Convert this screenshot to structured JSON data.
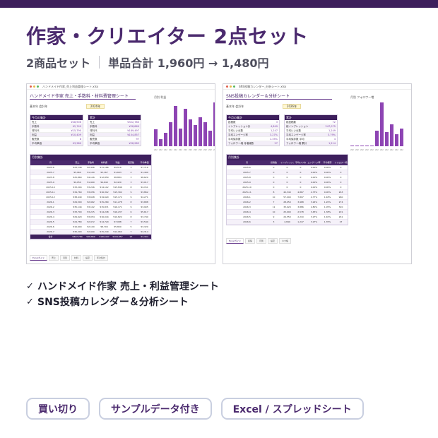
{
  "title": "作家・クリエイター 2点セット",
  "subtitle": {
    "count": "2商品セット",
    "price": "単品合計 1,960円 → 1,480円"
  },
  "colors": {
    "brand": "#3d1f5c",
    "accent": "#8d44b3",
    "text": "#4b2a6e"
  },
  "shots": [
    {
      "file_name": "ハンドメイド作家_売上利益管理シート.xlsx",
      "sheet_title": "ハンドメイド作家 売上・手数料・材料費管理シート",
      "meta_label": "基本年 会計年",
      "meta_value": "2026年",
      "box1": {
        "header": "今月の集計",
        "rows": [
          [
            "売上",
            "¥28,906"
          ],
          [
            "手数料",
            "¥2,749"
          ],
          [
            "材料代",
            "¥15,790"
          ],
          [
            "利益",
            "¥10,409"
          ],
          [
            "販売数",
            "8"
          ],
          [
            "平均単価",
            "¥3,580"
          ]
        ]
      },
      "box2": {
        "header": "累計",
        "rows": [
          [
            "売上",
            "¥322,780"
          ],
          [
            "手数料",
            "¥28,869"
          ],
          [
            "材料代",
            "¥189,497"
          ],
          [
            "利益",
            "¥104,857"
          ],
          [
            "販売数",
            "97"
          ],
          [
            "平均単価",
            "¥28,982"
          ]
        ]
      },
      "chart_title": "月別 利益",
      "bars": [
        0.38,
        0.16,
        0.3,
        0.55,
        0.92,
        0.4,
        0.86,
        0.62,
        0.48,
        0.66,
        0.55,
        0.35,
        1.0,
        0.4
      ],
      "xlabels": [
        "2025-7",
        "2025-8",
        "2025-9",
        "2025-10",
        "2025-11",
        "2025-12",
        "2026-1",
        "2026-2",
        "2026-3",
        "2026-4",
        "2026-5",
        "2026-6",
        "2026-7",
        "2026-8"
      ],
      "table_title": "月別集計",
      "columns": [
        "月",
        "売上",
        "手数料",
        "材料費",
        "利益",
        "販売数",
        "平均単価"
      ],
      "rows": [
        [
          "2025-6",
          "¥23,148",
          "¥2,446",
          "¥11,186",
          "¥9,516",
          "3",
          "¥7,716"
        ],
        [
          "2025-7",
          "¥5,960",
          "¥1,100",
          "¥3,167",
          "¥1,693",
          "4",
          "¥1,490"
        ],
        [
          "2025-8",
          "¥25,860",
          "¥4,126",
          "¥12,850",
          "¥8,884",
          "3",
          "¥8,620"
        ],
        [
          "2025-9",
          "¥9,050",
          "¥1,990",
          "¥4,640",
          "¥2,420",
          "3",
          "¥3,017"
        ],
        [
          "2025-10",
          "¥33,204",
          "¥3,246",
          "¥14,112",
          "¥15,846",
          "8",
          "¥4,151"
        ],
        [
          "2025-11",
          "¥34,760",
          "¥3,056",
          "¥16,312",
          "¥15,392",
          "9",
          "¥3,862"
        ],
        [
          "2025-12",
          "¥38,440",
          "¥3,648",
          "¥19,620",
          "¥15,172",
          "9",
          "¥4,271"
        ],
        [
          "2026-1",
          "¥29,500",
          "¥2,962",
          "¥15,260",
          "¥11,278",
          "8",
          "¥3,688"
        ],
        [
          "2026-2",
          "¥35,144",
          "¥3,102",
          "¥15,871",
          "¥16,171",
          "9",
          "¥3,905"
        ],
        [
          "2026-3",
          "¥33,700",
          "¥3,215",
          "¥14,248",
          "¥16,237",
          "6",
          "¥5,617"
        ],
        [
          "2026-4",
          "¥29,920",
          "¥3,054",
          "¥16,044",
          "¥10,822",
          "8",
          "¥3,740"
        ],
        [
          "2026-5",
          "¥24,780",
          "¥2,972",
          "¥14,720",
          "¥7,088",
          "7",
          "¥3,540"
        ],
        [
          "2026-6",
          "¥16,600",
          "¥2,100",
          "¥8,700",
          "¥5,800",
          "5",
          "¥3,320"
        ],
        [
          "2026-7",
          "¥30,200",
          "¥2,900",
          "¥15,240",
          "¥12,060",
          "7",
          "¥4,314"
        ]
      ],
      "total": [
        "合計",
        "¥327,780",
        "¥28,869",
        "¥189,497",
        "¥104,857",
        "97",
        "¥3,394"
      ],
      "tabs": [
        "Excelガイド",
        "売上",
        "月別",
        "材料",
        "設定",
        "年次集計"
      ]
    },
    {
      "file_name": "SNS投稿カレンダー_分析シート.xlsx",
      "sheet_title": "SNS投稿カレンダー＆分析シート",
      "meta_label": "基本年 会計年",
      "meta_value": "2026年",
      "box1": {
        "header": "今月の集計",
        "rows": [
          [
            "投稿数",
            "3"
          ],
          [
            "インプレッション計",
            "4,849"
          ],
          [
            "平均いいね数",
            "1,247"
          ],
          [
            "平均エンゲージ率",
            "3.27%"
          ],
          [
            "平均保存数",
            "1.35%"
          ],
          [
            "フォロワー増 月増減数",
            "27"
          ]
        ]
      },
      "box2": {
        "header": "累計",
        "rows": [
          [
            "総投稿数",
            "72"
          ],
          [
            "総インプレッション",
            "247,075"
          ],
          [
            "平均いいね数",
            "1,249"
          ],
          [
            "平均エンゲージ率",
            "3.79%"
          ],
          [
            "平均保存数 平均",
            "4"
          ],
          [
            "フォロワー増 累計",
            "1,514"
          ]
        ]
      },
      "chart_title": "月別 フォロワー増",
      "bars": [
        0.02,
        0.02,
        0.02,
        0.02,
        0.02,
        0.35,
        1.0,
        0.33,
        0.5,
        0.27,
        0.4
      ],
      "xlabels": [
        "2025-7",
        "2025-8",
        "2025-9",
        "2025-10",
        "2025-11",
        "2025-12",
        "2026-1",
        "2026-2",
        "2026-3",
        "2026-4",
        "2026-5"
      ],
      "table_title": "月別集計",
      "columns": [
        "月",
        "投稿数",
        "インプレッション",
        "平均いいね",
        "エンゲージ率",
        "平均保存",
        "フォロワー増"
      ],
      "rows": [
        [
          "2025-6",
          "0",
          "0",
          "0",
          "0.00%",
          "0.00%",
          "0"
        ],
        [
          "2025-7",
          "0",
          "0",
          "0",
          "0.00%",
          "0.00%",
          "0"
        ],
        [
          "2025-8",
          "0",
          "0",
          "0",
          "0.00%",
          "0.00%",
          "0"
        ],
        [
          "2025-9",
          "0",
          "0",
          "0",
          "0.00%",
          "0.00%",
          "0"
        ],
        [
          "2025-10",
          "0",
          "0",
          "0",
          "0.00%",
          "0.00%",
          "0"
        ],
        [
          "2025-11",
          "8",
          "40,340",
          "4,867",
          "4.73%",
          "0.00%",
          "263"
        ],
        [
          "2026-1",
          "10",
          "57,090",
          "7,897",
          "4.77%",
          "1.48%",
          "960"
        ],
        [
          "2026-2",
          "7",
          "28,050",
          "3,968",
          "3.24%",
          "1.20%",
          "274"
        ],
        [
          "2026-3",
          "11",
          "33,920",
          "3,886",
          "2.80%",
          "1.05%",
          "320"
        ],
        [
          "2026-4",
          "10",
          "25,990",
          "2,578",
          "3.45%",
          "1.38%",
          "201"
        ],
        [
          "2026-5",
          "9",
          "24,550",
          "2,210",
          "3.27%",
          "1.40%",
          "261"
        ],
        [
          "2026-6",
          "3",
          "4,849",
          "1,247",
          "3.27%",
          "1.35%",
          "27"
        ]
      ],
      "total": null,
      "tabs": [
        "Excelガイド",
        "投稿",
        "月別",
        "設定",
        "ネタ帳"
      ]
    }
  ],
  "features": [
    "ハンドメイド作家 売上・利益管理シート",
    "SNS投稿カレンダー＆分析シート"
  ],
  "tags": [
    "買い切り",
    "サンプルデータ付き",
    "Excel / スプレッドシート"
  ]
}
